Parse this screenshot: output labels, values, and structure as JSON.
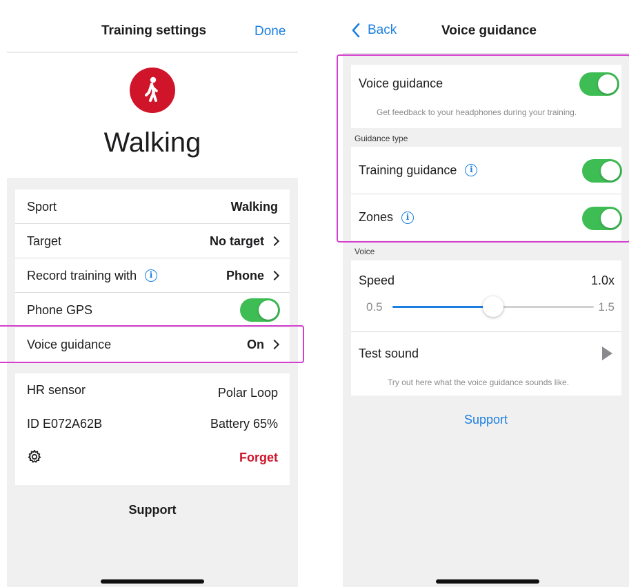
{
  "left": {
    "header": {
      "title": "Training settings",
      "done_label": "Done"
    },
    "sport_title": "Walking",
    "sport_icon": "walking-person-icon",
    "settings": {
      "sport": {
        "label": "Sport",
        "value": "Walking"
      },
      "target": {
        "label": "Target",
        "value": "No target"
      },
      "record": {
        "label": "Record training with",
        "value": "Phone"
      },
      "gps": {
        "label": "Phone GPS",
        "on": true
      },
      "voice": {
        "label": "Voice guidance",
        "value": "On"
      }
    },
    "hr": {
      "label": "HR sensor",
      "device": "Polar Loop",
      "id": "ID E072A62B",
      "battery": "Battery 65%",
      "forget_label": "Forget"
    },
    "support_label": "Support"
  },
  "right": {
    "header": {
      "back_label": "Back",
      "title": "Voice guidance"
    },
    "voice_guidance": {
      "label": "Voice guidance",
      "on": true,
      "caption": "Get feedback to your headphones during your training."
    },
    "guidance_type_label": "Guidance type",
    "training_guidance": {
      "label": "Training guidance",
      "on": true
    },
    "zones": {
      "label": "Zones",
      "on": true
    },
    "voice_section_label": "Voice",
    "speed": {
      "label": "Speed",
      "value": "1.0x",
      "min": "0.5",
      "max": "1.5",
      "level": 0.5
    },
    "test_sound": {
      "label": "Test sound",
      "caption": "Try out here what the voice guidance sounds like."
    },
    "support_label": "Support"
  },
  "colors": {
    "accent_blue": "#1b7fe0",
    "toggle_green": "#3ebd54",
    "forget_red": "#d0142a",
    "sport_red": "#d0142a",
    "highlight_magenta": "#d43fcf"
  }
}
